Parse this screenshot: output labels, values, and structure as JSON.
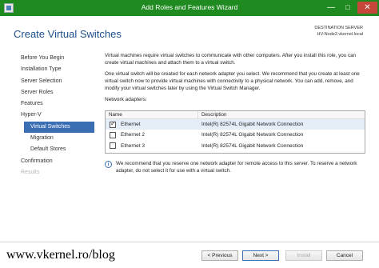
{
  "window": {
    "title": "Add Roles and Features Wizard",
    "buttons": {
      "minimize": "—",
      "maximize": "□",
      "close": "✕"
    }
  },
  "header": {
    "page_title": "Create Virtual Switches",
    "destination_label": "DESTINATION SERVER",
    "destination_value": "HV-Node2.vkernel.local"
  },
  "nav": {
    "items": [
      {
        "label": "Before You Begin",
        "state": "normal"
      },
      {
        "label": "Installation Type",
        "state": "normal"
      },
      {
        "label": "Server Selection",
        "state": "normal"
      },
      {
        "label": "Server Roles",
        "state": "normal"
      },
      {
        "label": "Features",
        "state": "normal"
      },
      {
        "label": "Hyper-V",
        "state": "normal"
      },
      {
        "label": "Virtual Switches",
        "state": "active"
      },
      {
        "label": "Migration",
        "state": "sub"
      },
      {
        "label": "Default Stores",
        "state": "sub"
      },
      {
        "label": "Confirmation",
        "state": "normal"
      },
      {
        "label": "Results",
        "state": "disabled"
      }
    ]
  },
  "content": {
    "para1": "Virtual machines require virtual switches to communicate with other computers. After you install this role, you can create virtual machines and attach them to a virtual switch.",
    "para2": "One virtual switch will be created for each network adapter you select. We recommend that you create at least one virtual switch now to provide virtual machines with connectivity to a physical network. You can add, remove, and modify your virtual switches later by using the Virtual Switch Manager.",
    "adapters_label": "Network adapters:"
  },
  "table": {
    "columns": {
      "name": "Name",
      "description": "Description"
    },
    "rows": [
      {
        "name": "Ethernet",
        "description": "Intel(R) 82574L Gigabit Network Connection",
        "checked": true
      },
      {
        "name": "Ethernet 2",
        "description": "Intel(R) 82574L Gigabit Network Connection",
        "checked": false
      },
      {
        "name": "Ethernet 3",
        "description": "Intel(R) 82574L Gigabit Network Connection",
        "checked": false
      }
    ]
  },
  "info": {
    "icon": "i",
    "text": "We recommend that you reserve one network adapter for remote access to this server. To reserve a network adapter, do not select it for use with a virtual switch."
  },
  "footer": {
    "previous": "< Previous",
    "next": "Next >",
    "install": "Install",
    "cancel": "Cancel"
  },
  "watermark": "www.vkernel.ro/blog",
  "colors": {
    "titlebar": "#1f8a1f",
    "accent": "#3a6fb4",
    "title_text": "#1e4f8a"
  }
}
